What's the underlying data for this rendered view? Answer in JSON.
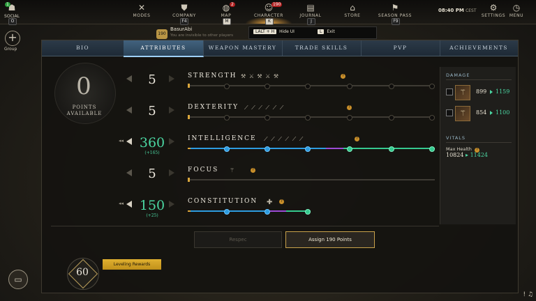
{
  "nav": {
    "social": {
      "label": "SOCIAL",
      "key": "O",
      "badge": "1"
    },
    "items": [
      {
        "label": "MODES",
        "key": "",
        "icon": "swords-icon"
      },
      {
        "label": "COMPANY",
        "key": "F4",
        "icon": "shield-icon"
      },
      {
        "label": "MAP",
        "key": "M",
        "icon": "globe-icon",
        "badge": "2"
      },
      {
        "label": "CHARACTER",
        "key": "K",
        "icon": "character-icon",
        "badge": "190"
      },
      {
        "label": "JOURNAL",
        "key": "J",
        "icon": "journal-icon"
      },
      {
        "label": "STORE",
        "key": "",
        "icon": "store-icon"
      },
      {
        "label": "SEASON PASS",
        "key": "F9",
        "icon": "season-pass-icon"
      }
    ],
    "clock": {
      "time": "08:40 PM",
      "zone": "CEST"
    },
    "settings_label": "SETTINGS",
    "menu_label": "MENU"
  },
  "sidebar": {
    "group_label": "Group"
  },
  "player": {
    "level": "190",
    "name": "BasurAbi",
    "status": "You are invisible to other players"
  },
  "hotkeys": {
    "hide": {
      "key": "LALT + H",
      "label": "Hide UI"
    },
    "exit": {
      "key": "L",
      "label": "Exit"
    }
  },
  "tabs": [
    "BIO",
    "ATTRIBUTES",
    "WEAPON MASTERY",
    "TRADE SKILLS",
    "PVP",
    "ACHIEVEMENTS"
  ],
  "active_tab": "ATTRIBUTES",
  "points": {
    "value": "0",
    "label_line1": "POINTS",
    "label_line2": "AVAILABLE"
  },
  "attributes": [
    {
      "name": "STRENGTH",
      "value": "5",
      "bonus": "",
      "progress": 0
    },
    {
      "name": "DEXTERITY",
      "value": "5",
      "bonus": "",
      "progress": 0
    },
    {
      "name": "INTELLIGENCE",
      "value": "360",
      "bonus": "(+165)",
      "progress": 1.0
    },
    {
      "name": "FOCUS",
      "value": "5",
      "bonus": "",
      "progress": 0
    },
    {
      "name": "CONSTITUTION",
      "value": "150",
      "bonus": "(+25)",
      "progress": 0.5
    }
  ],
  "damage": {
    "title": "DAMAGE",
    "rows": [
      {
        "old": "899",
        "new": "1159"
      },
      {
        "old": "854",
        "new": "1100"
      }
    ]
  },
  "vitals": {
    "title": "VITALS",
    "label": "Max Health",
    "old": "10824",
    "new": "11424"
  },
  "buttons": {
    "respec": "Respec",
    "assign": "Assign  190  Points",
    "leveling_rewards": "Leveling Rewards"
  },
  "level": "60",
  "colors": {
    "accent_green": "#4bd6a2",
    "accent_blue": "#2d9ce0",
    "gold": "#d9a63c"
  }
}
